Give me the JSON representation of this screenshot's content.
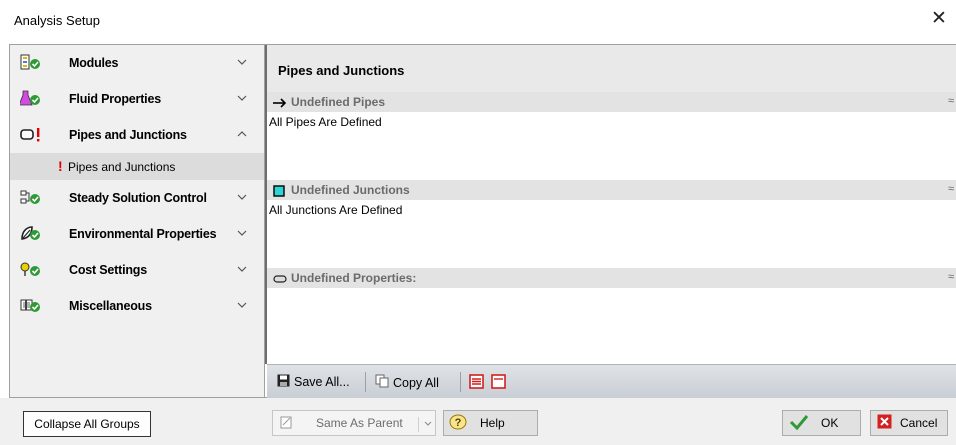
{
  "window": {
    "title": "Analysis Setup",
    "close_glyph": "✕"
  },
  "sidebar": {
    "groups": [
      {
        "label": "Modules",
        "icon": "modules-icon",
        "expanded": false
      },
      {
        "label": "Fluid Properties",
        "icon": "fluid-properties-icon",
        "expanded": false
      },
      {
        "label": "Pipes and Junctions",
        "icon": "pipes-junctions-icon",
        "expanded": true
      },
      {
        "label": "Steady Solution Control",
        "icon": "steady-solution-icon",
        "expanded": false
      },
      {
        "label": "Environmental Properties",
        "icon": "environmental-icon",
        "expanded": false
      },
      {
        "label": "Cost Settings",
        "icon": "cost-settings-icon",
        "expanded": false
      },
      {
        "label": "Miscellaneous",
        "icon": "miscellaneous-icon",
        "expanded": false
      }
    ],
    "subitem": {
      "label": "Pipes and Junctions",
      "status": "!"
    }
  },
  "main": {
    "header": "Pipes and Junctions",
    "sections": [
      {
        "title": "Undefined Pipes",
        "body": "All Pipes Are Defined",
        "icon": "pipe-arrow-icon"
      },
      {
        "title": "Undefined Junctions",
        "body": "All Junctions Are Defined",
        "icon": "junction-square-icon"
      },
      {
        "title": "Undefined Properties:",
        "body": "",
        "icon": "properties-pill-icon"
      }
    ],
    "collapse_glyph": "≈"
  },
  "toolbar": {
    "save_all": "Save All...",
    "copy_all": "Copy All"
  },
  "footer": {
    "collapse_all": "Collapse All Groups",
    "same_as_parent": "Same As Parent",
    "help": "Help",
    "ok": "OK",
    "cancel": "Cancel"
  },
  "colors": {
    "check_green": "#2e9a36",
    "warning_red": "#e00000",
    "junction_cyan": "#2ed3d3"
  }
}
